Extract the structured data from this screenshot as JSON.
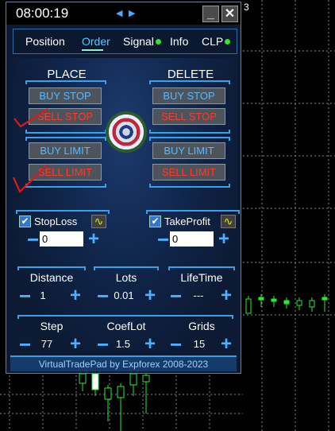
{
  "window": {
    "clock": "08:00:19",
    "nav_left": "◀",
    "nav_right": "▶",
    "minimize": "_",
    "close": "✕"
  },
  "tabs": [
    {
      "label": "Position"
    },
    {
      "label": "Order"
    },
    {
      "label": "Signal"
    },
    {
      "label": "Info"
    },
    {
      "label": "CLP"
    }
  ],
  "order": {
    "place_header": "PLACE",
    "delete_header": "DELETE",
    "place": {
      "buy_stop": "BUY STOP",
      "sell_stop": "SELL STOP",
      "buy_limit": "BUY LIMIT",
      "sell_limit": "SELL LIMIT"
    },
    "delete": {
      "buy_stop": "BUY STOP",
      "sell_stop": "SELL STOP",
      "buy_limit": "BUY LIMIT",
      "sell_limit": "SELL LIMIT"
    }
  },
  "stoploss": {
    "label": "StopLoss",
    "checked": "✔",
    "value": "0"
  },
  "takeprofit": {
    "label": "TakeProfit",
    "checked": "✔",
    "value": "0"
  },
  "fields_row1": [
    {
      "label": "Distance",
      "value": "1"
    },
    {
      "label": "Lots",
      "value": "0.01"
    },
    {
      "label": "LifeTime",
      "value": "---"
    }
  ],
  "fields_row2": [
    {
      "label": "Step",
      "value": "77"
    },
    {
      "label": "CoefLot",
      "value": "1.5"
    },
    {
      "label": "Grids",
      "value": "15"
    }
  ],
  "controls": {
    "minus": "−",
    "plus": "+",
    "wave": "∿"
  },
  "footer": "VirtualTradePad by Expforex 2008-2023",
  "chart_axis_label": "3",
  "colors": {
    "accent": "#3aa0e8",
    "buy": "#59b8ff",
    "sell": "#ff3a2a",
    "active_tab": "#58c8ff",
    "status_dot": "#2ee82e",
    "candle_up": "#2ee82e"
  }
}
